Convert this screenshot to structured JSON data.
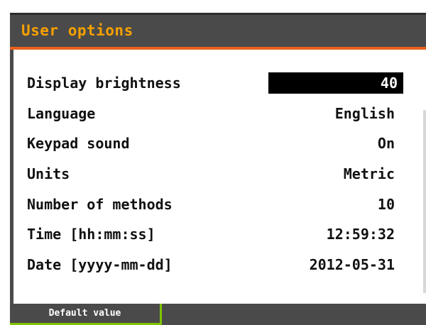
{
  "header": {
    "title": "User options"
  },
  "options": [
    {
      "label": "Display brightness",
      "value": "40",
      "selected": true
    },
    {
      "label": "Language",
      "value": "English",
      "selected": false
    },
    {
      "label": "Keypad sound",
      "value": "On",
      "selected": false
    },
    {
      "label": "Units",
      "value": "Metric",
      "selected": false
    },
    {
      "label": "Number of methods",
      "value": "10",
      "selected": false
    },
    {
      "label": "Time [hh:mm:ss]",
      "value": "12:59:32",
      "selected": false
    },
    {
      "label": "Date [yyyy-mm-dd]",
      "value": "2012-05-31",
      "selected": false
    }
  ],
  "softkeys": {
    "left_label": "Default value"
  },
  "colors": {
    "title_text": "#f5a000",
    "accent_rule": "#e8601c",
    "bar_background": "#4a4a4a",
    "softkey_accent": "#7fc400",
    "selection_background": "#000000"
  }
}
